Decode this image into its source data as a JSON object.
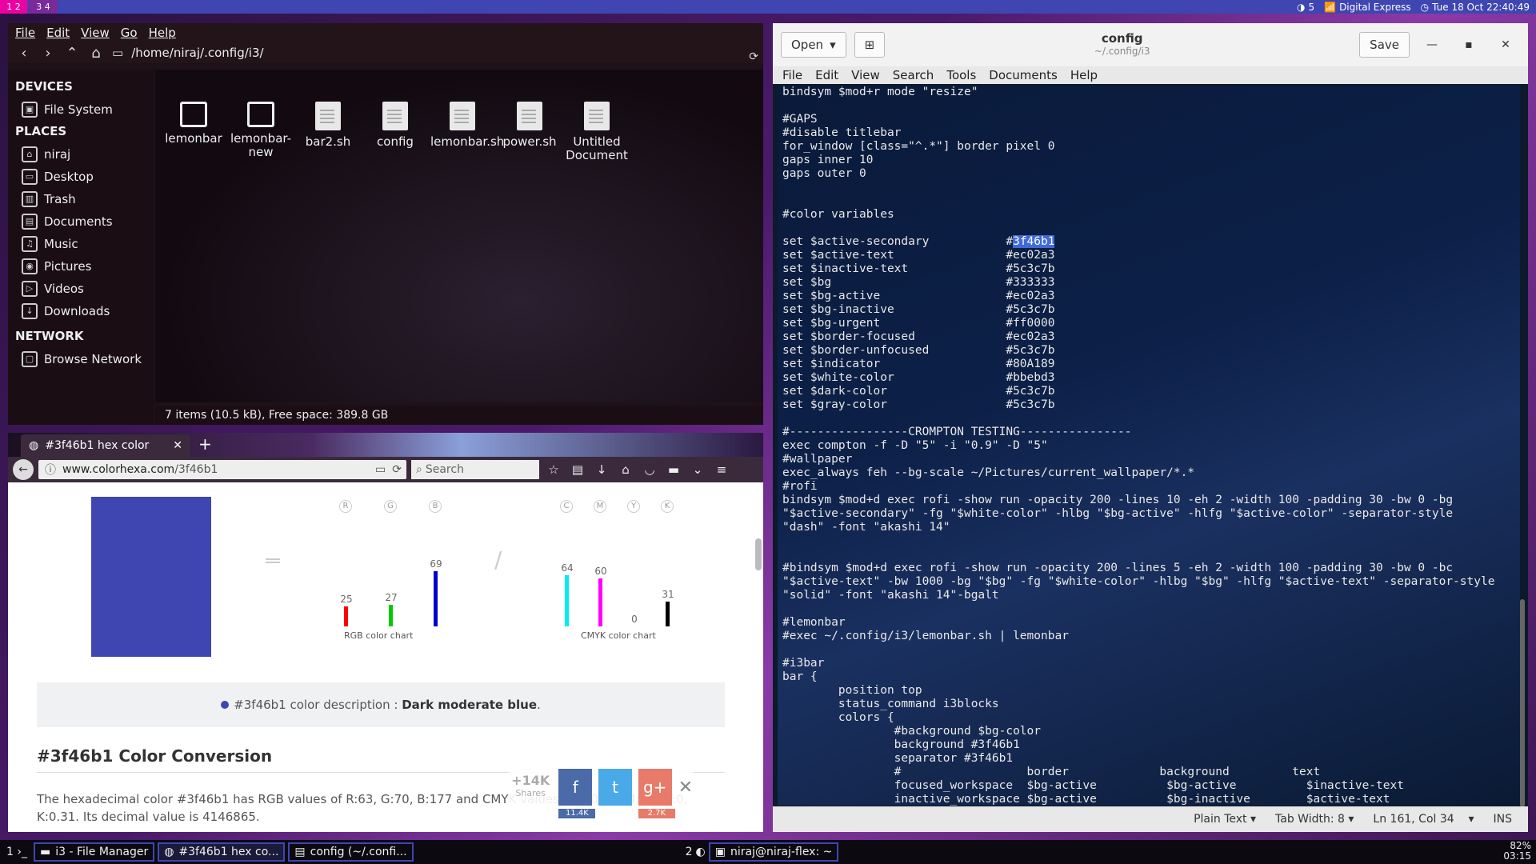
{
  "topbar": {
    "ws1": "1 2",
    "ws2": "3 4",
    "brightness": "5",
    "wifi": "Digital Express",
    "datetime": "Tue 18 Oct 22:40:49"
  },
  "fm": {
    "menu": [
      "File",
      "Edit",
      "View",
      "Go",
      "Help"
    ],
    "path": "/home/niraj/.config/i3/",
    "devices_h": "DEVICES",
    "fs": "File System",
    "places_h": "PLACES",
    "places": [
      "niraj",
      "Desktop",
      "Trash",
      "Documents",
      "Music",
      "Pictures",
      "Videos",
      "Downloads"
    ],
    "network_h": "NETWORK",
    "browse": "Browse Network",
    "files": [
      "lemonbar",
      "lemonbar-new",
      "bar2.sh",
      "config",
      "lemonbar.sh",
      "power.sh",
      "Untitled Document"
    ],
    "status": "7 items (10.5 kB), Free space: 389.8 GB"
  },
  "ff": {
    "tab_title": "#3f46b1 hex color",
    "url_host": "www.colorhexa.com",
    "url_path": "/3f46b1",
    "search_placeholder": "Search",
    "rgb_heads": [
      "R",
      "G",
      "B"
    ],
    "cmyk_heads": [
      "C",
      "M",
      "Y",
      "K"
    ],
    "rgb_values": [
      25,
      27,
      69
    ],
    "cmyk_values": [
      64,
      60,
      0,
      31
    ],
    "rgb_caption": "RGB color chart",
    "cmyk_caption": "CMYK color chart",
    "desc_prefix": "#3f46b1 color description : ",
    "desc_name": "Dark moderate blue",
    "desc_suffix": ".",
    "conv_heading": "#3f46b1 Color Conversion",
    "conv_text": "The hexadecimal color #3f46b1 has RGB values of R:63, G:70, B:177 and CMYK values of C:0.64, M:0.6, Y:0, K:0.31. Its decimal value is 4146865.",
    "shares_count": "+14K",
    "shares_label": "Shares",
    "fb": "f",
    "fb_count": "11.4K",
    "tw": "t",
    "gp": "g+",
    "gp_count": "2.7K",
    "colors": {
      "swatch": "#3f46b1"
    }
  },
  "ged": {
    "open": "Open",
    "title": "config",
    "subtitle": "~/.config/i3",
    "save": "Save",
    "menu": [
      "File",
      "Edit",
      "View",
      "Search",
      "Tools",
      "Documents",
      "Help"
    ],
    "lines": [
      "bindsym $mod+r mode \"resize\"",
      "",
      "#GAPS",
      "#disable titlebar",
      "for_window [class=\"^.*\"] border pixel 0",
      "gaps inner 10",
      "gaps outer 0",
      "",
      "",
      "#color variables",
      "",
      "set $active-secondary           #3f46b1",
      "set $active-text                #ec02a3",
      "set $inactive-text              #5c3c7b",
      "set $bg                         #333333",
      "set $bg-active                  #ec02a3",
      "set $bg-inactive                #5c3c7b",
      "set $bg-urgent                  #ff0000",
      "set $border-focused             #ec02a3",
      "set $border-unfocused           #5c3c7b",
      "set $indicator                  #80A189",
      "set $white-color                #bbebd3",
      "set $dark-color                 #5c3c7b",
      "set $gray-color                 #5c3c7b",
      "",
      "#-----------------CROMPTON TESTING----------------",
      "exec compton -f -D \"5\" -i \"0.9\" -D \"5\"",
      "#wallpaper",
      "exec_always feh --bg-scale ~/Pictures/current_wallpaper/*.*",
      "#rofi",
      "bindsym $mod+d exec rofi -show run -opacity 200 -lines 10 -eh 2 -width 100 -padding 30 -bw 0 -bg",
      "\"$active-secondary\" -fg \"$white-color\" -hlbg \"$bg-active\" -hlfg \"$active-color\" -separator-style",
      "\"dash\" -font \"akashi 14\"",
      "",
      "",
      "#bindsym $mod+d exec rofi -show run -opacity 200 -lines 5 -eh 2 -width 100 -padding 30 -bw 0 -bc",
      "\"$active-text\" -bw 1000 -bg \"$bg\" -fg \"$white-color\" -hlbg \"$bg\" -hlfg \"$active-text\" -separator-style",
      "\"solid\" -font \"akashi 14\"-bgalt",
      "",
      "#lemonbar",
      "#exec ~/.config/i3/lemonbar.sh | lemonbar",
      "",
      "#i3bar",
      "bar {",
      "        position top",
      "        status_command i3blocks",
      "        colors {",
      "                #background $bg-color",
      "                background #3f46b1",
      "                separator #3f46b1",
      "                #                  border             background         text",
      "                focused_workspace  $bg-active          $bg-active          $inactive-text",
      "                inactive_workspace $bg-active          $bg-inactive        $active-text"
    ],
    "status_lang": "Plain Text",
    "status_tab": "Tab Width: 8",
    "status_pos": "Ln 161, Col 34",
    "status_ins": "INS"
  },
  "bottombar": {
    "launcher": "1 ›_",
    "tasks": [
      "i3 - File Manager",
      "#3f46b1 hex co...",
      "config (~/.confi..."
    ],
    "ws": "2",
    "term": "niraj@niraj-flex: ~",
    "battery": "82%",
    "time": "03:15"
  }
}
